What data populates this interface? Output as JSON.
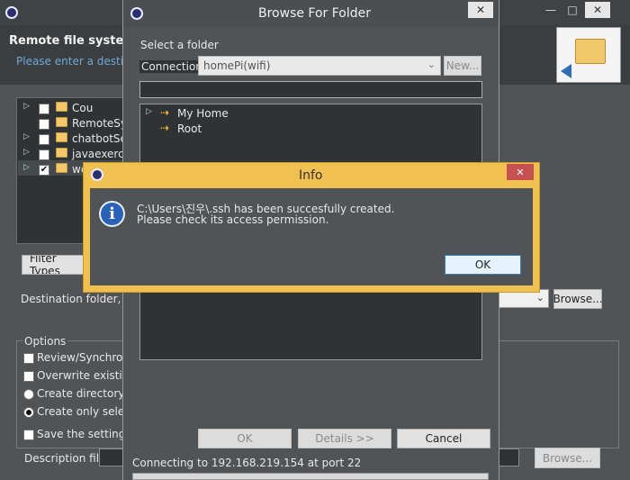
{
  "bg_window": {
    "title": "Remote file system",
    "subtitle": "Please enter a destinati",
    "tree_items": [
      {
        "label": "Cou",
        "checked": false
      },
      {
        "label": "RemoteSys",
        "checked": false
      },
      {
        "label": "chatbotSer",
        "checked": false
      },
      {
        "label": "javaexercis",
        "checked": false
      },
      {
        "label": "we",
        "checked": true
      }
    ],
    "filter_types_label": "Filter Types",
    "destination_label": "Destination folder, qu",
    "browse_label": "Browse...",
    "options_label": "Options",
    "options": [
      {
        "type": "checkbox",
        "label": "Review/Synchroniz"
      },
      {
        "type": "checkbox",
        "label": "Overwrite existing"
      },
      {
        "type": "radio",
        "label": "Create directory st",
        "selected": false
      },
      {
        "type": "radio",
        "label": "Create only selecte",
        "selected": true
      }
    ],
    "save_settings_label": "Save the settings",
    "description_label": "Description file:",
    "browse2_label": "Browse..."
  },
  "browse_dialog": {
    "title": "Browse For Folder",
    "select_label": "Select a folder",
    "connection_label": "Connection:",
    "connection_value": "homePi(wifi)",
    "new_label": "New...",
    "tree": [
      {
        "label": "My Home"
      },
      {
        "label": "Root"
      }
    ],
    "ok_label": "OK",
    "details_label": "Details >>",
    "cancel_label": "Cancel",
    "status": "Connecting to 192.168.219.154 at port 22"
  },
  "info_dialog": {
    "title": "Info",
    "message_line1": "C:\\Users\\진우\\.ssh has been succesfully created.",
    "message_line2": "Please check its access permission.",
    "ok_label": "OK",
    "info_glyph": "i",
    "close_glyph": "✕"
  },
  "window_controls": {
    "minimize": "—",
    "maximize": "□",
    "close": "✕"
  },
  "colors": {
    "dialog_bg": "#505456",
    "dark_panel": "#2f3335",
    "info_border": "#f0c050",
    "close_red": "#c75050"
  }
}
